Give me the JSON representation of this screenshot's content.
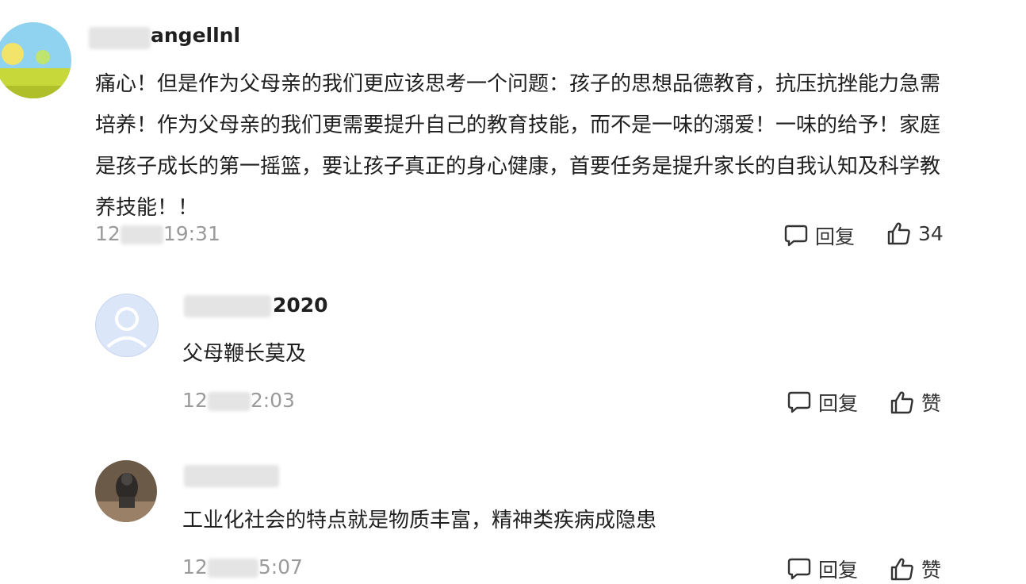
{
  "comments": [
    {
      "username": "angellnl",
      "text": "痛心！但是作为父母亲的我们更应该思考一个问题：孩子的思想品德教育，抗压抗挫能力急需培养！作为父母亲的我们更需要提升自己的教育技能，而不是一味的溺爱！一味的给予！家庭是孩子成长的第一摇篮，要让孩子真正的身心健康，首要任务是提升家长的自我认知及科学教养技能！！",
      "time_prefix": "12",
      "time_suffix": "19:31",
      "reply_label": "回复",
      "like_label": "34"
    },
    {
      "username": "2020",
      "text": "父母鞭长莫及",
      "time_prefix": "12",
      "time_suffix": "2:03",
      "reply_label": "回复",
      "like_label": "赞"
    },
    {
      "username": "",
      "text": "工业化社会的特点就是物质丰富，精神类疾病成隐患",
      "time_prefix": "12",
      "time_suffix": "5:07",
      "reply_label": "回复",
      "like_label": "赞"
    }
  ],
  "icons": {
    "reply": "speech-bubble-icon",
    "like": "thumbs-up-icon"
  },
  "colors": {
    "text": "#1f1f1f",
    "meta": "#9a9a9a",
    "avatar_default": "#dbe6f8"
  }
}
